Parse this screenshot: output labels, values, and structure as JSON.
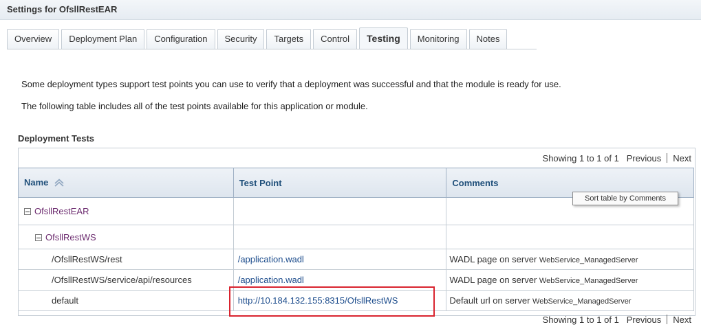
{
  "page": {
    "title": "Settings for OfsllRestEAR"
  },
  "tabs": [
    {
      "label": "Overview"
    },
    {
      "label": "Deployment Plan"
    },
    {
      "label": "Configuration"
    },
    {
      "label": "Security"
    },
    {
      "label": "Targets"
    },
    {
      "label": "Control"
    },
    {
      "label": "Testing"
    },
    {
      "label": "Monitoring"
    },
    {
      "label": "Notes"
    }
  ],
  "active_tab": "Testing",
  "intro": {
    "line1": "Some deployment types support test points you can use to verify that a deployment was successful and that the module is ready for use.",
    "line2": "The following table includes all of the test points available for this application or module."
  },
  "deployment_tests": {
    "title": "Deployment Tests",
    "pager": {
      "showing": "Showing 1 to 1 of 1",
      "previous": "Previous",
      "next": "Next"
    },
    "columns": {
      "name": "Name",
      "test_point": "Test Point",
      "comments": "Comments"
    },
    "tooltip": "Sort table by Comments",
    "rows": [
      {
        "name": "OfsllRestEAR",
        "test_point": "",
        "comment_prefix": "",
        "comment_server": ""
      },
      {
        "name": "OfsllRestWS",
        "test_point": "",
        "comment_prefix": "",
        "comment_server": ""
      },
      {
        "name": "/OfsllRestWS/rest",
        "test_point": "/application.wadl",
        "comment_prefix": "WADL page on server",
        "comment_server": "WebService_ManagedServer"
      },
      {
        "name": "/OfsllRestWS/service/api/resources",
        "test_point": "/application.wadl",
        "comment_prefix": "WADL page on server",
        "comment_server": "WebService_ManagedServer"
      },
      {
        "name": "default",
        "test_point": "http://10.184.132.155:8315/OfsllRestWS",
        "comment_prefix": "Default url on server",
        "comment_server": "WebService_ManagedServer"
      }
    ]
  },
  "icons": {
    "sort": "sort-ascending-icon",
    "expander": "collapse-icon"
  },
  "colors": {
    "header_text": "#1f4f7a",
    "link": "#1c4c8c",
    "tree_node": "#6b2a6e",
    "highlight": "#d9232e"
  }
}
